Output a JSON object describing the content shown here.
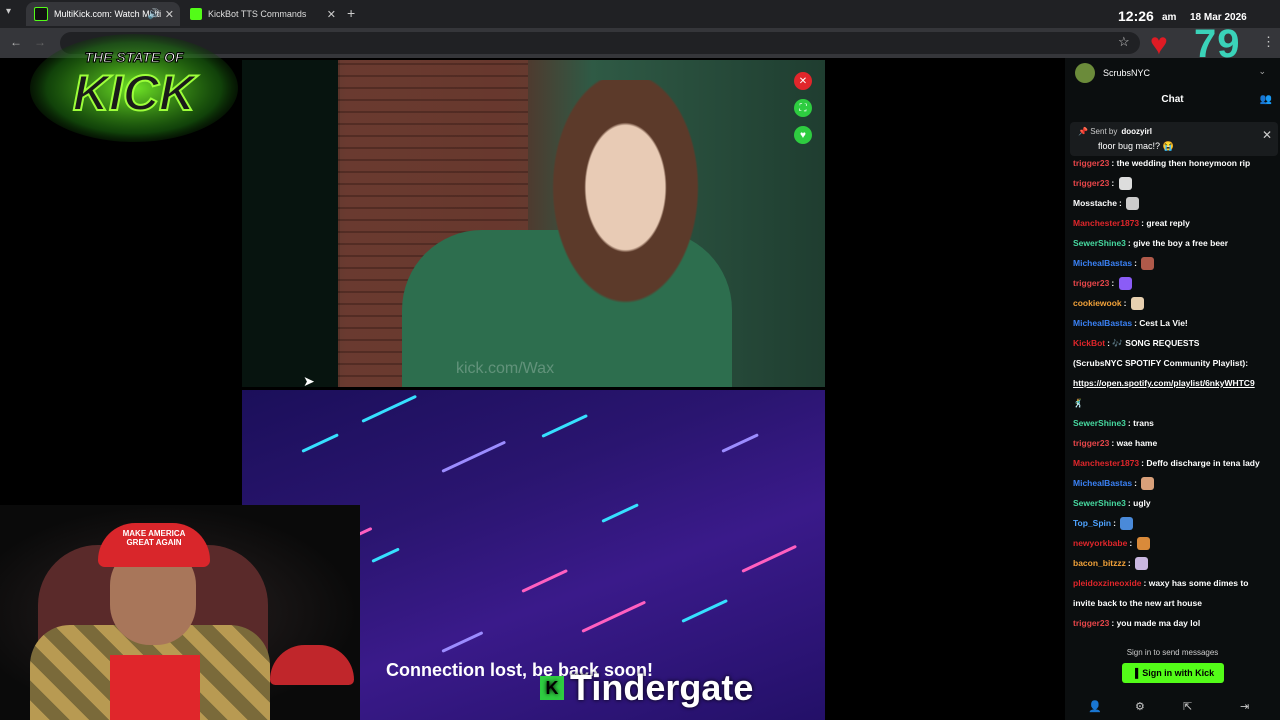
{
  "tabs": [
    {
      "title": "MultiKick.com: Watch Multi",
      "active": true
    },
    {
      "title": "KickBot TTS Commands",
      "active": false
    }
  ],
  "clock": {
    "time": "12:26",
    "ampm": "am",
    "date": "18 Mar 2026"
  },
  "viewer_count": "79",
  "logo": {
    "line1": "THE STATE OF",
    "line2": "KICK"
  },
  "video": {
    "watermark": "kick.com/Wax",
    "status_text": "Connection lost, be back soon!",
    "ticker": "Tindergate",
    "ticker_k": "K"
  },
  "webcam": {
    "hat_text": "MAKE AMERICA GREAT AGAIN"
  },
  "chat": {
    "channel": "ScrubsNYC",
    "title": "Chat",
    "pinned": {
      "sent_by_label": "Sent by",
      "sent_by_user": "doozyirl",
      "message": "floor bug mac!? 😭"
    },
    "messages": [
      {
        "user": "trigger23",
        "color": "#e7464a",
        "text": "the wedding then honeymoon rip"
      },
      {
        "user": "trigger23",
        "color": "#e7464a",
        "text": "",
        "emote": "#dddddd"
      },
      {
        "user": "Mosstache",
        "color": "#ffffff",
        "text": "",
        "emote": "#cccccc"
      },
      {
        "user": "Manchester1873",
        "color": "#e0262b",
        "text": "great reply"
      },
      {
        "user": "SewerShine3",
        "color": "#47d9a0",
        "text": "give the boy a free beer"
      },
      {
        "user": "MichealBastas",
        "color": "#3b82f6",
        "text": "",
        "emote": "#b05a4a"
      },
      {
        "user": "trigger23",
        "color": "#e7464a",
        "text": "",
        "emote": "#8b5cf6"
      },
      {
        "user": "cookiewook",
        "color": "#f2a23a",
        "text": "",
        "emote": "#e8d0b0"
      },
      {
        "user": "MichealBastas",
        "color": "#3b82f6",
        "text": "Cest La Vie!"
      },
      {
        "user": "KickBot",
        "color": "#e0262b",
        "text": "🎶 SONG REQUESTS"
      },
      {
        "user": "",
        "color": "#ffffff",
        "text": "(ScrubsNYC SPOTIFY Community Playlist):"
      },
      {
        "user": "",
        "color": "#ffffff",
        "text": "https://open.spotify.com/playlist/6nkyWHTC9",
        "link": true
      },
      {
        "user": "",
        "color": "#ffffff",
        "text": "🕺"
      },
      {
        "user": "SewerShine3",
        "color": "#47d9a0",
        "text": "trans"
      },
      {
        "user": "trigger23",
        "color": "#e7464a",
        "text": "wae hame"
      },
      {
        "user": "Manchester1873",
        "color": "#e0262b",
        "text": "Deffo discharge in tena lady"
      },
      {
        "user": "MichealBastas",
        "color": "#3b82f6",
        "text": "",
        "emote": "#d9a07a"
      },
      {
        "user": "SewerShine3",
        "color": "#47d9a0",
        "text": "ugly"
      },
      {
        "user": "Top_Spin",
        "color": "#4fa3ff",
        "text": "",
        "emote": "#4a8ad9"
      },
      {
        "user": "newyorkbabe",
        "color": "#e0262b",
        "text": "",
        "emote": "#d98a3a"
      },
      {
        "user": "bacon_bitzzz",
        "color": "#f2a23a",
        "text": "",
        "emote": "#c9b7e0"
      },
      {
        "user": "pleidoxzineoxide",
        "color": "#e0262b",
        "text": "waxy has some dimes to"
      },
      {
        "user": "",
        "color": "#ffffff",
        "text": "invite back to the new art house"
      },
      {
        "user": "trigger23",
        "color": "#e7464a",
        "text": "you made ma day lol"
      }
    ],
    "signin_prompt": "Sign in to send messages",
    "signin_button": "Sign in with Kick"
  }
}
